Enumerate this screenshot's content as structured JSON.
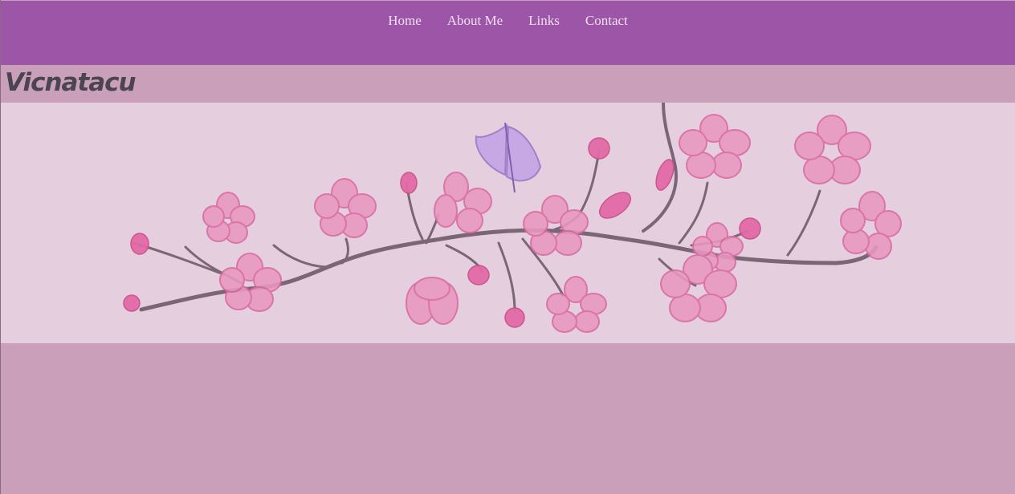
{
  "nav": {
    "items": [
      {
        "label": "Home"
      },
      {
        "label": "About Me"
      },
      {
        "label": "Links"
      },
      {
        "label": "Contact"
      }
    ]
  },
  "header": {
    "title": "Vicnatacu"
  },
  "banner": {
    "image_name": "cherry-blossom-branch-illustration"
  },
  "colors": {
    "navbar": "#9d55a7",
    "nav_text": "#f2e0f1",
    "page_background": "#c99fba",
    "banner_background": "#e5cfdf",
    "title_text": "#4a4550",
    "blossom": "#e898bf",
    "blossom_edge": "#d86aa3",
    "branch": "#7a6676",
    "butterfly": "#b08ad0"
  }
}
